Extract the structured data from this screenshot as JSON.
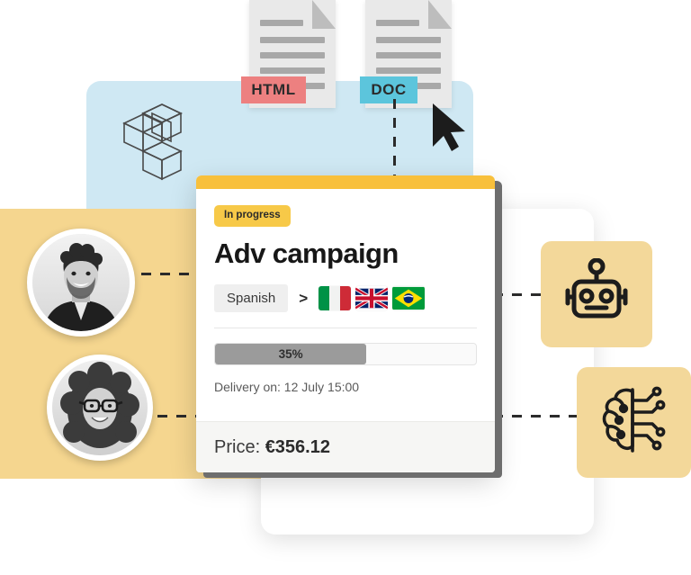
{
  "illustration": {
    "title": "Translation project card illustration",
    "accent_yellow": "#F7C948",
    "panel_yellow": "#F5D68F",
    "panel_blue": "#CFE8F3",
    "html_tag_color": "#ED8080",
    "doc_tag_color": "#5CC5DC"
  },
  "documents": [
    {
      "id": "html",
      "tag": "HTML",
      "icon": "document-icon",
      "color": "#ED8080"
    },
    {
      "id": "doc",
      "tag": "DOC",
      "icon": "document-icon",
      "color": "#5CC5DC"
    }
  ],
  "decor": {
    "cube_icon": "isometric-cube-icon",
    "cursor_icon": "mouse-cursor-icon"
  },
  "avatars": [
    {
      "id": "avatar-1",
      "name": "avatar-translator-1"
    },
    {
      "id": "avatar-2",
      "name": "avatar-translator-2"
    }
  ],
  "ai_tiles": [
    {
      "id": "robot",
      "icon": "robot-icon"
    },
    {
      "id": "brain",
      "icon": "ai-brain-circuit-icon"
    }
  ],
  "card": {
    "status_badge": "In progress",
    "title": "Adv campaign",
    "source_language": "Spanish",
    "arrow": ">",
    "target_flags": [
      {
        "code": "it",
        "name": "Italy"
      },
      {
        "code": "gb",
        "name": "United Kingdom"
      },
      {
        "code": "br",
        "name": "Brazil"
      }
    ],
    "progress": {
      "label": "35%",
      "value": 35,
      "fill_ratio": 58
    },
    "delivery": "Delivery on: 12 July 15:00",
    "price_label": "Price:",
    "price_amount": "€356.12"
  }
}
